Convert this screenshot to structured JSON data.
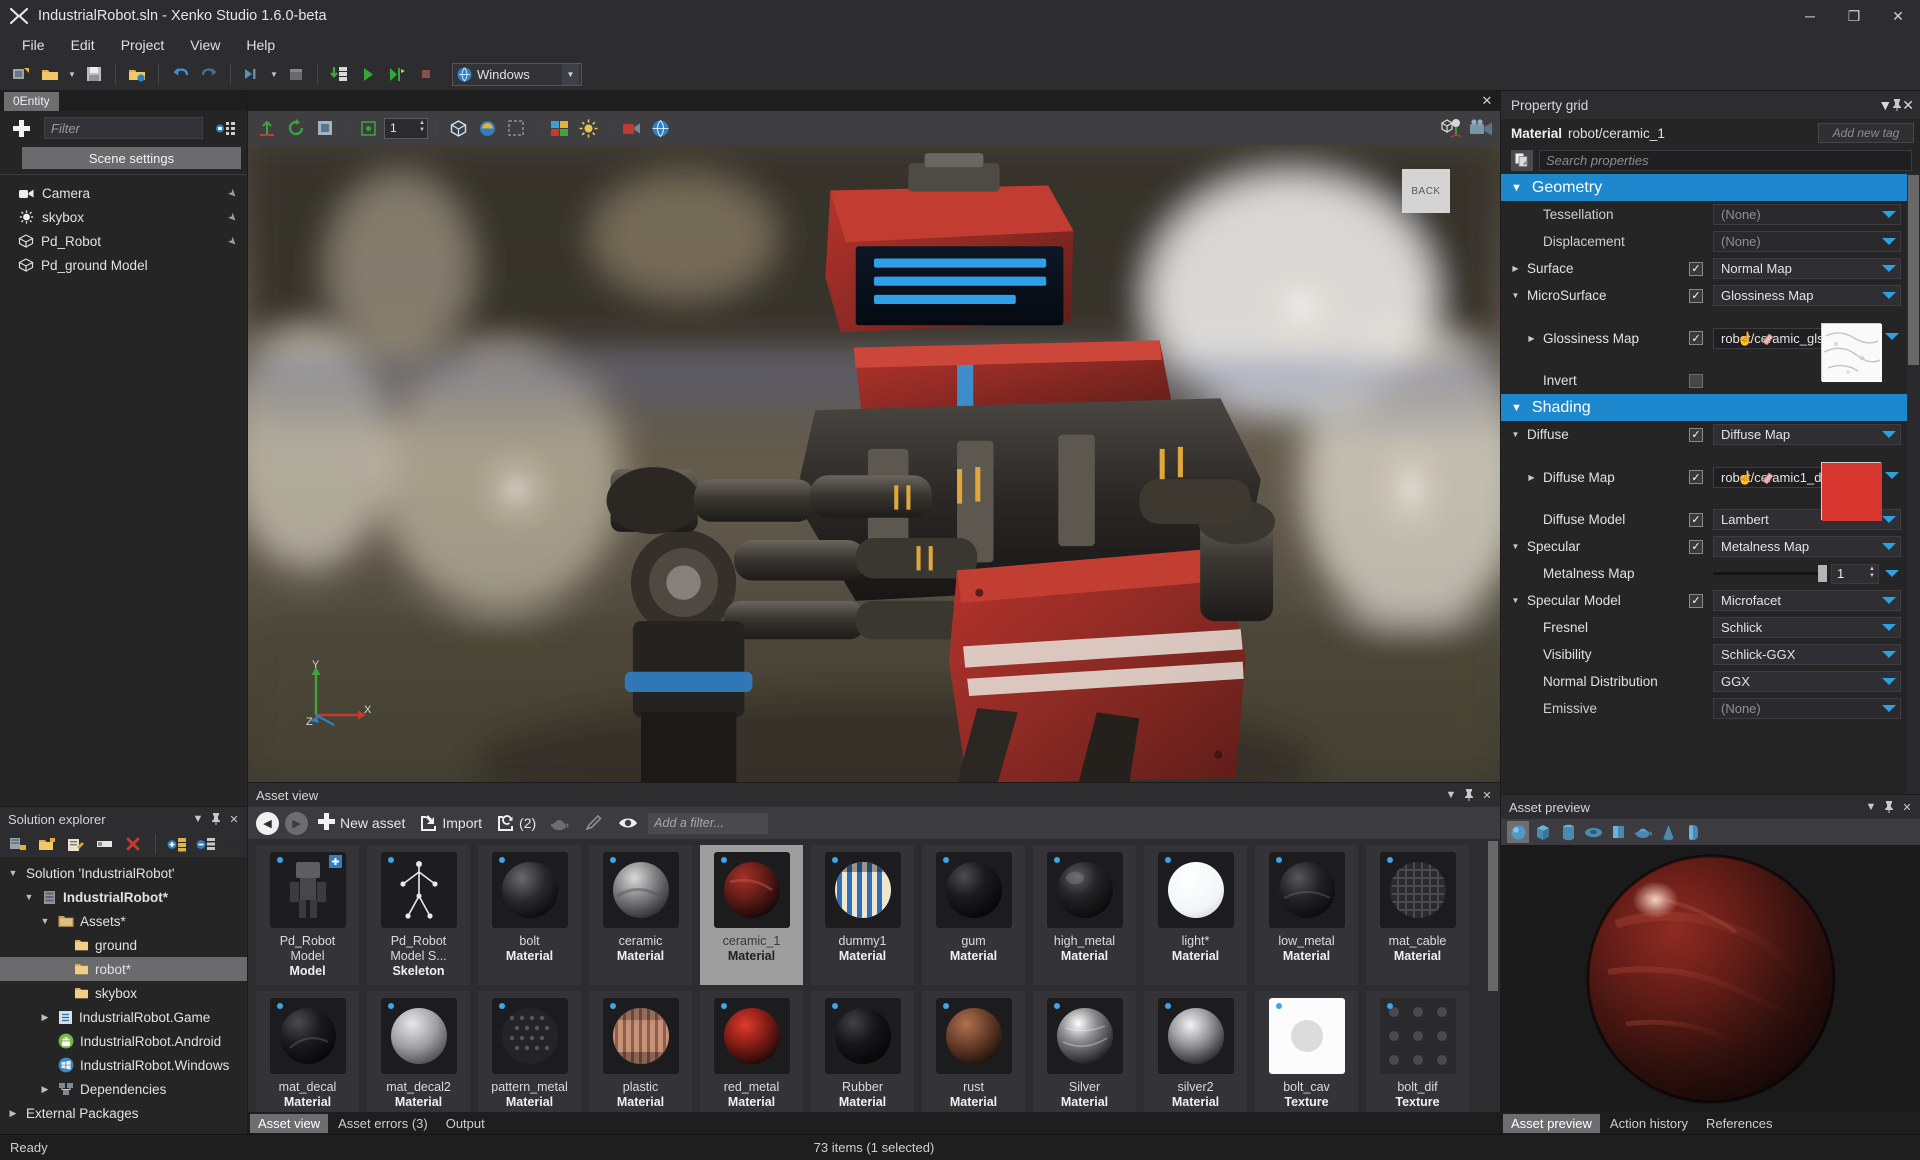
{
  "window": {
    "title": "IndustrialRobot.sln - Xenko Studio 1.6.0-beta",
    "minimize": "─",
    "maximize": "❐",
    "close": "✕"
  },
  "menu": {
    "items": [
      "File",
      "Edit",
      "Project",
      "Help_placeholder"
    ]
  },
  "menubar": {
    "items": [
      "File",
      "Edit",
      "Project",
      "View",
      "Help"
    ]
  },
  "toolbar": {
    "platform": "Windows",
    "icons": [
      "new-project-icon",
      "open-folder-icon",
      "save-icon",
      "open-asset-icon",
      "undo-icon",
      "redo-icon",
      "build-icon",
      "package-icon",
      "reload-assemblies-icon",
      "run-icon",
      "run-debug-icon",
      "stop-icon"
    ]
  },
  "scene_explorer": {
    "tab": "0Entity",
    "filter_placeholder": "Filter",
    "scene_settings_label": "Scene settings",
    "entities": [
      {
        "label": "Camera",
        "icon": "camera-icon"
      },
      {
        "label": "skybox",
        "icon": "light-icon"
      },
      {
        "label": "Pd_Robot",
        "icon": "entity-icon"
      },
      {
        "label": "Pd_ground Model",
        "icon": "entity-icon"
      }
    ]
  },
  "viewport": {
    "close_label": "✕",
    "counter": "1",
    "nav_cube_label": "BACK",
    "axis_x": "X",
    "axis_y": "Y",
    "axis_z": "Z"
  },
  "solution_explorer": {
    "title": "Solution explorer",
    "collapse": "▼",
    "pin": "▮",
    "close": "✕",
    "tree": [
      {
        "label": "Solution 'IndustrialRobot'",
        "indent": 0,
        "twisty": "open",
        "icon": "none",
        "bold": false,
        "selected": false
      },
      {
        "label": "IndustrialRobot*",
        "indent": 1,
        "twisty": "open",
        "icon": "package",
        "bold": true,
        "selected": false
      },
      {
        "label": "Assets*",
        "indent": 2,
        "twisty": "open",
        "icon": "assets",
        "bold": false,
        "selected": false
      },
      {
        "label": "ground",
        "indent": 3,
        "twisty": "none",
        "icon": "folder",
        "bold": false,
        "selected": false
      },
      {
        "label": "robot*",
        "indent": 3,
        "twisty": "none",
        "icon": "folder",
        "bold": false,
        "selected": true
      },
      {
        "label": "skybox",
        "indent": 3,
        "twisty": "none",
        "icon": "folder",
        "bold": false,
        "selected": false
      },
      {
        "label": "IndustrialRobot.Game",
        "indent": 2,
        "twisty": "closed",
        "icon": "csharp",
        "bold": false,
        "selected": false
      },
      {
        "label": "IndustrialRobot.Android",
        "indent": 2,
        "twisty": "none",
        "icon": "android",
        "bold": false,
        "selected": false
      },
      {
        "label": "IndustrialRobot.Windows",
        "indent": 2,
        "twisty": "none",
        "icon": "windows",
        "bold": false,
        "selected": false
      },
      {
        "label": "Dependencies",
        "indent": 2,
        "twisty": "closed",
        "icon": "deps",
        "bold": false,
        "selected": false
      },
      {
        "label": "External Packages",
        "indent": 0,
        "twisty": "closed",
        "icon": "none",
        "bold": false,
        "selected": false
      }
    ]
  },
  "asset_view": {
    "title": "Asset view",
    "collapse": "▼",
    "pin": "▮",
    "close": "✕",
    "back_label": "◀",
    "forward_label": "▶",
    "new_asset_label": "New asset",
    "import_label": "Import",
    "pending_count": "(2)",
    "filter_placeholder": "Add a filter...",
    "assets": [
      {
        "name": "Pd_Robot",
        "name2": "Model",
        "type": "Model",
        "thumb": "robot-model",
        "selected": false,
        "badge": true
      },
      {
        "name": "Pd_Robot",
        "name2": "Model S...",
        "type": "Skeleton",
        "thumb": "skeleton",
        "selected": false,
        "badge": false
      },
      {
        "name": "bolt",
        "name2": "",
        "type": "Material",
        "thumb": "dark-sphere",
        "selected": false,
        "badge": false
      },
      {
        "name": "ceramic",
        "name2": "",
        "type": "Material",
        "thumb": "gray-sphere",
        "selected": false,
        "badge": false
      },
      {
        "name": "ceramic_1",
        "name2": "",
        "type": "Material",
        "thumb": "red-sphere",
        "selected": true,
        "badge": false
      },
      {
        "name": "dummy1",
        "name2": "",
        "type": "Material",
        "thumb": "blue-stripes",
        "selected": false,
        "badge": false
      },
      {
        "name": "gum",
        "name2": "",
        "type": "Material",
        "thumb": "black-sphere",
        "selected": false,
        "badge": false
      },
      {
        "name": "high_metal",
        "name2": "",
        "type": "Material",
        "thumb": "metal-sphere",
        "selected": false,
        "badge": false
      },
      {
        "name": "light*",
        "name2": "",
        "type": "Material",
        "thumb": "white-sphere",
        "selected": false,
        "badge": false
      },
      {
        "name": "low_metal",
        "name2": "",
        "type": "Material",
        "thumb": "lowmetal-sphere",
        "selected": false,
        "badge": false
      },
      {
        "name": "mat_cable",
        "name2": "",
        "type": "Material",
        "thumb": "cable-sphere",
        "selected": false,
        "badge": false
      },
      {
        "name": "mat_decal",
        "name2": "",
        "type": "Material",
        "thumb": "decal-sphere",
        "selected": false,
        "badge": false
      },
      {
        "name": "mat_decal2",
        "name2": "",
        "type": "Material",
        "thumb": "lightgray-sphere",
        "selected": false,
        "badge": false
      },
      {
        "name": "pattern_metal",
        "name2": "",
        "type": "Material",
        "thumb": "pattern-sphere",
        "selected": false,
        "badge": false
      },
      {
        "name": "plastic",
        "name2": "",
        "type": "Material",
        "thumb": "stripe-sphere",
        "selected": false,
        "badge": false
      },
      {
        "name": "red_metal",
        "name2": "",
        "type": "Material",
        "thumb": "redmetal-sphere",
        "selected": false,
        "badge": false
      },
      {
        "name": "Rubber",
        "name2": "",
        "type": "Material",
        "thumb": "rubber-sphere",
        "selected": false,
        "badge": false
      },
      {
        "name": "rust",
        "name2": "",
        "type": "Material",
        "thumb": "rust-sphere",
        "selected": false,
        "badge": false
      },
      {
        "name": "Silver",
        "name2": "",
        "type": "Material",
        "thumb": "silver-sphere",
        "selected": false,
        "badge": false
      },
      {
        "name": "silver2",
        "name2": "",
        "type": "Material",
        "thumb": "silver2-sphere",
        "selected": false,
        "badge": false
      },
      {
        "name": "bolt_cav",
        "name2": "",
        "type": "Texture",
        "thumb": "white-tex",
        "selected": false,
        "badge": false
      },
      {
        "name": "bolt_dif",
        "name2": "",
        "type": "Texture",
        "thumb": "dark-tex",
        "selected": false,
        "badge": false
      }
    ],
    "tabs": [
      {
        "label": "Asset view",
        "active": true
      },
      {
        "label": "Asset errors (3)",
        "active": false
      },
      {
        "label": "Output",
        "active": false
      }
    ]
  },
  "property_grid": {
    "title": "Property grid",
    "collapse": "▼",
    "pin": "▮",
    "close": "✕",
    "subject_type": "Material",
    "subject_name": "robot/ceramic_1",
    "add_tag_placeholder": "Add new tag",
    "search_placeholder": "Search properties",
    "sections": [
      {
        "name": "Geometry",
        "rows": [
          {
            "label": "Tessellation",
            "indent": 1,
            "expander": "none",
            "checkbox": "none",
            "control": "dropdown",
            "value": "(None)",
            "dim": true
          },
          {
            "label": "Displacement",
            "indent": 1,
            "expander": "none",
            "checkbox": "none",
            "control": "dropdown",
            "value": "(None)",
            "dim": true
          },
          {
            "label": "Surface",
            "indent": 0,
            "expander": "closed",
            "checkbox": "on",
            "control": "dropdown",
            "value": "Normal Map",
            "dim": false
          },
          {
            "label": "MicroSurface",
            "indent": 0,
            "expander": "open",
            "checkbox": "on",
            "control": "dropdown",
            "value": "Glossiness Map",
            "dim": false
          },
          {
            "label": "Glossiness Map",
            "indent": 1,
            "expander": "closed",
            "checkbox": "on",
            "control": "texture",
            "value": "robot/ceramic_gls",
            "swatch": "glossiness",
            "dim": false
          },
          {
            "label": "Invert",
            "indent": 1,
            "expander": "none",
            "checkbox": "off",
            "control": "checkonly",
            "value": "",
            "dim": false
          }
        ]
      },
      {
        "name": "Shading",
        "rows": [
          {
            "label": "Diffuse",
            "indent": 0,
            "expander": "open",
            "checkbox": "on",
            "control": "dropdown",
            "value": "Diffuse Map",
            "dim": false
          },
          {
            "label": "Diffuse Map",
            "indent": 1,
            "expander": "closed",
            "checkbox": "on",
            "control": "texture",
            "value": "robot/ceramic1_dif",
            "swatch": "red",
            "dim": false
          },
          {
            "label": "Diffuse Model",
            "indent": 1,
            "expander": "none",
            "checkbox": "on",
            "control": "dropdown",
            "value": "Lambert",
            "dim": false
          },
          {
            "label": "Specular",
            "indent": 0,
            "expander": "open",
            "checkbox": "on",
            "control": "dropdown",
            "value": "Metalness Map",
            "dim": false
          },
          {
            "label": "Metalness Map",
            "indent": 1,
            "expander": "none",
            "checkbox": "none",
            "control": "slider",
            "value": "1",
            "dim": false
          },
          {
            "label": "Specular Model",
            "indent": 0,
            "expander": "open",
            "checkbox": "on",
            "control": "dropdown",
            "value": "Microfacet",
            "dim": false
          },
          {
            "label": "Fresnel",
            "indent": 1,
            "expander": "none",
            "checkbox": "none",
            "control": "dropdown",
            "value": "Schlick",
            "dim": false
          },
          {
            "label": "Visibility",
            "indent": 1,
            "expander": "none",
            "checkbox": "none",
            "control": "dropdown",
            "value": "Schlick-GGX",
            "dim": false
          },
          {
            "label": "Normal Distribution",
            "indent": 1,
            "expander": "none",
            "checkbox": "none",
            "control": "dropdown",
            "value": "GGX",
            "dim": false
          },
          {
            "label": "Emissive",
            "indent": 1,
            "expander": "none",
            "checkbox": "none",
            "control": "dropdown",
            "value": "(None)",
            "dim": true
          }
        ]
      }
    ],
    "colors": {
      "section_header": "#1e88cf",
      "diffuse_swatch": "#d8372f"
    }
  },
  "asset_preview": {
    "title": "Asset preview",
    "collapse": "▼",
    "pin": "▮",
    "close": "✕",
    "shapes": [
      "sphere-preview",
      "cube-preview",
      "cylinder-preview",
      "torus-preview",
      "plane-preview",
      "teapot-preview",
      "cone-preview",
      "capsule-preview"
    ],
    "tabs": [
      {
        "label": "Asset preview",
        "active": true
      },
      {
        "label": "Action history",
        "active": false
      },
      {
        "label": "References",
        "active": false
      }
    ]
  },
  "statusbar": {
    "left": "Ready",
    "center": "73 items (1 selected)"
  }
}
